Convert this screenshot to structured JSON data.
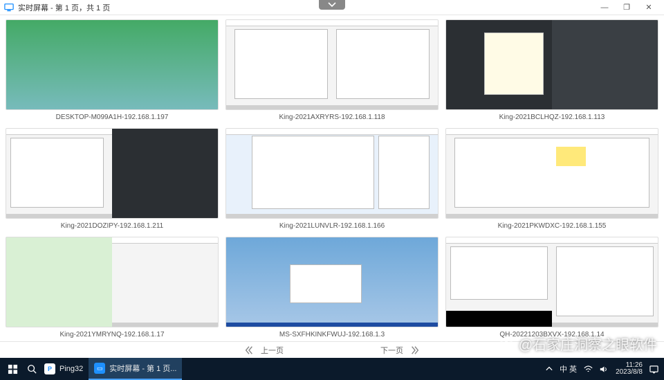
{
  "window": {
    "title": "实时屏幕 - 第 1 页，共 1 页",
    "handle_icon": "chevron-down-icon",
    "buttons": {
      "min": "—",
      "max": "❐",
      "close": "✕"
    }
  },
  "tiles": [
    {
      "label": "DESKTOP-M099A1H-192.168.1.197"
    },
    {
      "label": "King-2021AXRYRS-192.168.1.118"
    },
    {
      "label": "King-2021BCLHQZ-192.168.1.113"
    },
    {
      "label": "King-2021DOZIPY-192.168.1.211"
    },
    {
      "label": "King-2021LUNVLR-192.168.1.166"
    },
    {
      "label": "King-2021PKWDXC-192.168.1.155"
    },
    {
      "label": "King-2021YMRYNQ-192.168.1.17"
    },
    {
      "label": "MS-SXFHKINKFWUJ-192.168.1.3"
    },
    {
      "label": "QH-20221203BXVX-192.168.1.14"
    }
  ],
  "pager": {
    "prev": "上一页",
    "next": "下一页"
  },
  "watermark": {
    "handle": "@石家庄洞察之眼软件"
  },
  "taskbar": {
    "tasks": [
      {
        "icon": "P",
        "label": "Ping32"
      },
      {
        "icon": "▭",
        "label": "实时屏幕 - 第 1 页..."
      }
    ],
    "tray": {
      "ime": "中 英",
      "time": "11:26",
      "date": "2023/8/8"
    }
  }
}
